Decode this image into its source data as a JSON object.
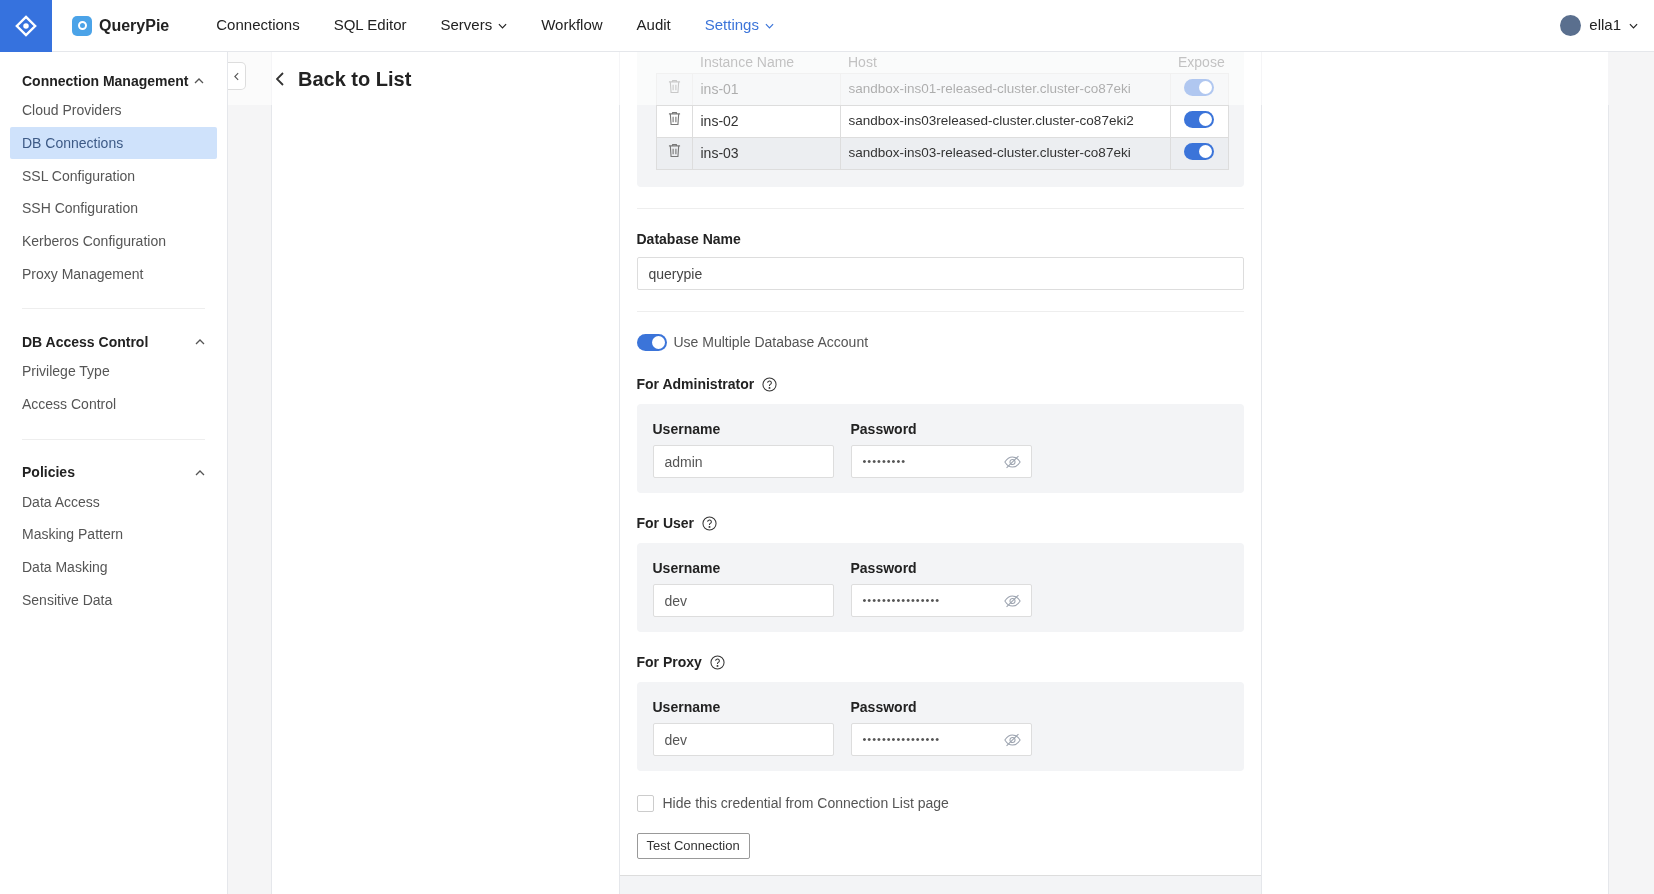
{
  "app": {
    "name": "QueryPie"
  },
  "nav": [
    {
      "label": "Connections",
      "selected": false,
      "dropdown": false
    },
    {
      "label": "SQL Editor",
      "selected": false,
      "dropdown": false
    },
    {
      "label": "Servers",
      "selected": false,
      "dropdown": true
    },
    {
      "label": "Workflow",
      "selected": false,
      "dropdown": false
    },
    {
      "label": "Audit",
      "selected": false,
      "dropdown": false
    },
    {
      "label": "Settings",
      "selected": true,
      "dropdown": true
    }
  ],
  "user": {
    "name": "ella1"
  },
  "sidebar": {
    "groups": [
      {
        "title": "Connection Management",
        "expanded": true,
        "items": [
          {
            "label": "Cloud Providers",
            "selected": false
          },
          {
            "label": "DB Connections",
            "selected": true
          },
          {
            "label": "SSL Configuration",
            "selected": false
          },
          {
            "label": "SSH Configuration",
            "selected": false
          },
          {
            "label": "Kerberos Configuration",
            "selected": false
          },
          {
            "label": "Proxy Management",
            "selected": false
          }
        ]
      },
      {
        "title": "DB Access Control",
        "expanded": true,
        "items": [
          {
            "label": "Privilege Type",
            "selected": false
          },
          {
            "label": "Access Control",
            "selected": false
          }
        ]
      },
      {
        "title": "Policies",
        "expanded": true,
        "items": [
          {
            "label": "Data Access",
            "selected": false
          },
          {
            "label": "Masking Pattern",
            "selected": false
          },
          {
            "label": "Data Masking",
            "selected": false
          },
          {
            "label": "Sensitive Data",
            "selected": false
          }
        ]
      }
    ]
  },
  "header": {
    "back_label": "Back to List"
  },
  "instances": {
    "columns": [
      "Instance Name",
      "Host",
      "Expose"
    ],
    "rows": [
      {
        "name": "ins-01",
        "host": "sandbox-ins01-released-cluster.cluster-co87eki",
        "expose": true
      },
      {
        "name": "ins-02",
        "host": "sandbox-ins03released-cluster.cluster-co87eki2",
        "expose": true
      },
      {
        "name": "ins-03",
        "host": "sandbox-ins03-released-cluster.cluster-co87eki",
        "expose": true
      }
    ]
  },
  "database_name": {
    "label": "Database Name",
    "value": "querypie"
  },
  "multiple_accounts": {
    "label": "Use Multiple Database Account",
    "on": true
  },
  "accounts": [
    {
      "title": "For Administrator",
      "username_label": "Username",
      "password_label": "Password",
      "username": "admin",
      "password": "•••••••••"
    },
    {
      "title": "For User",
      "username_label": "Username",
      "password_label": "Password",
      "username": "dev",
      "password": "••••••••••••••••"
    },
    {
      "title": "For Proxy",
      "username_label": "Username",
      "password_label": "Password",
      "username": "dev",
      "password": "••••••••••••••••"
    }
  ],
  "hide_credential": {
    "label": "Hide this credential from Connection List page",
    "checked": false
  },
  "test_button": {
    "label": "Test Connection"
  }
}
